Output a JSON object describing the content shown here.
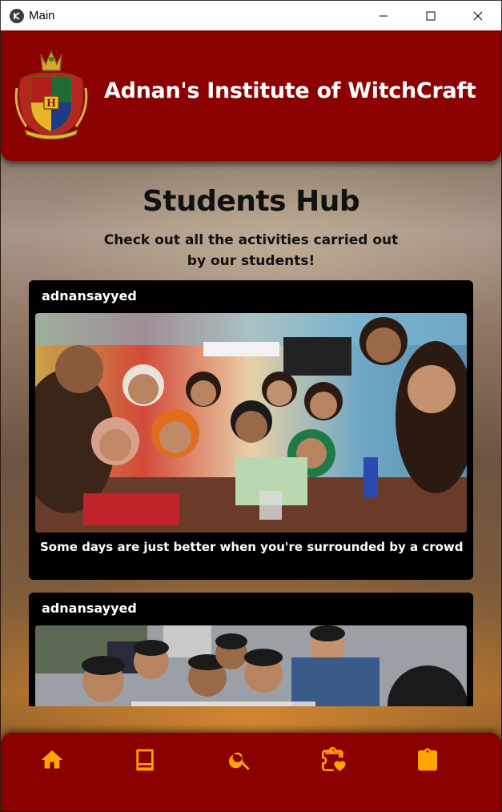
{
  "window": {
    "title": "Main",
    "app_icon": "kivy-icon",
    "controls": [
      "minimize-icon",
      "maximize-icon",
      "close-icon"
    ]
  },
  "header": {
    "logo": "hogwarts-crest",
    "title": "Adnan's Institute of WitchCraft",
    "background_color": "#8b0000"
  },
  "hub": {
    "title": "Students Hub",
    "subtitle_line1": "Check out all the activities carried out",
    "subtitle_line2": "by our students!"
  },
  "posts": [
    {
      "username": "adnansayyed",
      "photo": "group selfie of students at a restaurant table",
      "caption": "Some days are just better when you're surrounded by a crowd"
    },
    {
      "username": "adnansayyed",
      "photo": "group selfie of students on a street",
      "caption": ""
    }
  ],
  "bottom_nav": {
    "accent_color": "#ffa500",
    "items": [
      {
        "name": "home-icon"
      },
      {
        "name": "book-icon"
      },
      {
        "name": "search-icon"
      },
      {
        "name": "extension-heart-icon"
      },
      {
        "name": "clipboard-icon"
      }
    ]
  }
}
